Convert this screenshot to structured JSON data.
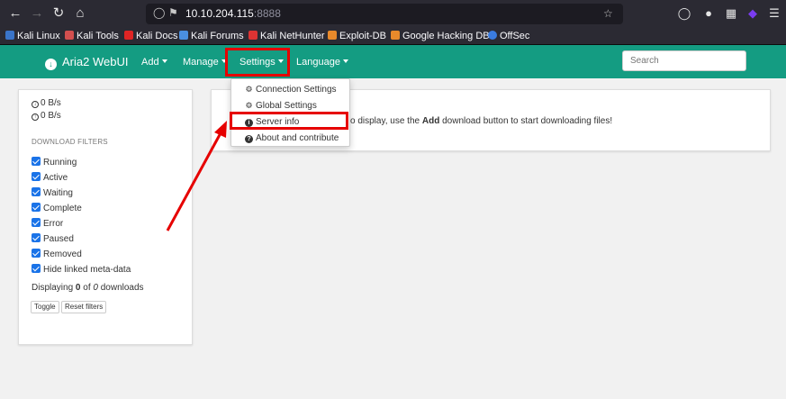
{
  "browser": {
    "url_host": "10.10.204.115",
    "url_port": ":8888",
    "bookmarks": [
      "Kali Linux",
      "Kali Tools",
      "Kali Docs",
      "Kali Forums",
      "Kali NetHunter",
      "Exploit-DB",
      "Google Hacking DB",
      "OffSec"
    ]
  },
  "navbar": {
    "brand": "Aria2 WebUI",
    "items": [
      "Add",
      "Manage",
      "Settings",
      "Language"
    ],
    "search_placeholder": "Search"
  },
  "sidebar": {
    "download_speed": "0 B/s",
    "upload_speed": "0 B/s",
    "filters_title": "DOWNLOAD FILTERS",
    "filters": [
      "Running",
      "Active",
      "Waiting",
      "Complete",
      "Error",
      "Paused",
      "Removed",
      "Hide linked meta-data"
    ],
    "displaying_prefix": "Displaying ",
    "displaying_count": "0",
    "displaying_of": " of ",
    "displaying_total": "0",
    "displaying_suffix": " downloads",
    "toggle_label": "Toggle",
    "reset_label": "Reset filters"
  },
  "main": {
    "message_prefix": "o display, use the ",
    "message_bold": "Add",
    "message_suffix": " download button to start downloading files!"
  },
  "settings_menu": {
    "items": [
      "Connection Settings",
      "Global Settings",
      "Server info",
      "About and contribute"
    ]
  },
  "colors": {
    "navbar": "#149c82",
    "highlight": "#e60000",
    "checkbox": "#1a73e8"
  }
}
